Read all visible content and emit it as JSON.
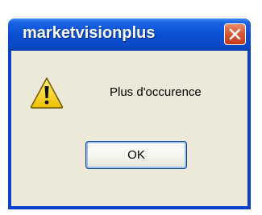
{
  "dialog": {
    "title": "marketvisionplus",
    "message": "Plus d'occurence",
    "ok_label": "OK",
    "icon": "warning-icon",
    "close_icon": "close-icon"
  },
  "colors": {
    "titlebar": "#0b4fd4",
    "close_button": "#d95a37",
    "client_background": "#ece9d8",
    "warning_yellow": "#f5d21f"
  }
}
